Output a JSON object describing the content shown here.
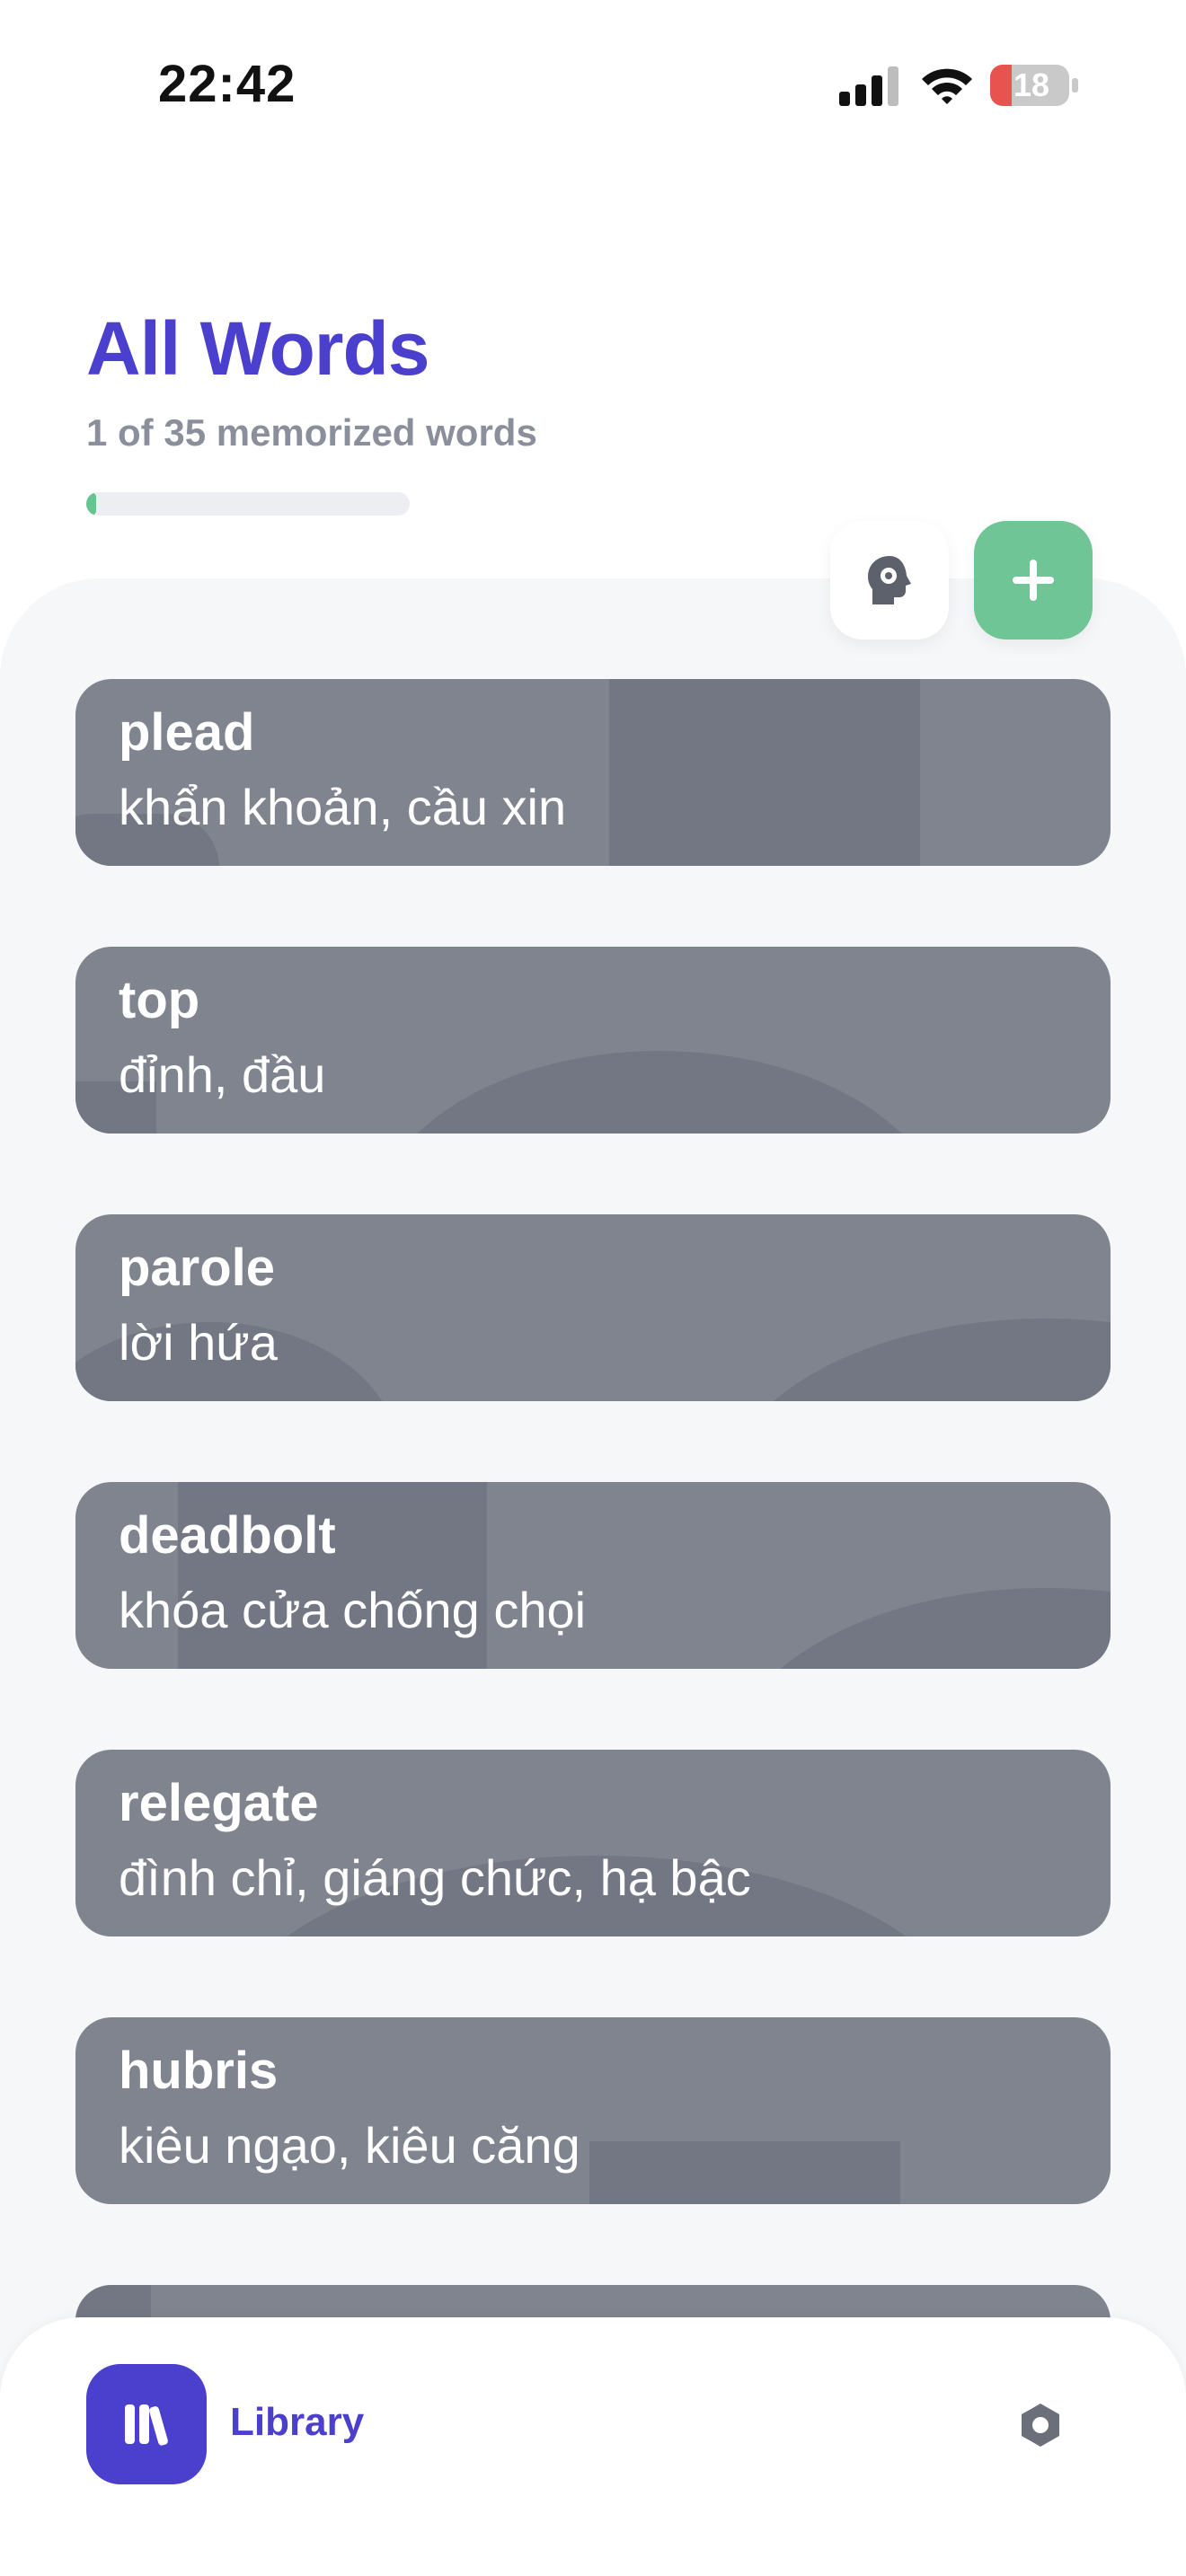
{
  "status_bar": {
    "time": "22:42",
    "battery_level": "18"
  },
  "header": {
    "title": "All Words",
    "subtitle": "1 of 35 memorized words",
    "progress_fraction": 0.03
  },
  "actions": {
    "memorize_icon": "head-icon",
    "add_icon": "plus-icon"
  },
  "words": [
    {
      "term": "plead",
      "meaning": "khẩn khoản, cầu xin"
    },
    {
      "term": "top",
      "meaning": "đỉnh, đầu"
    },
    {
      "term": "parole",
      "meaning": "lời hứa"
    },
    {
      "term": "deadbolt",
      "meaning": "khóa cửa chống chọi"
    },
    {
      "term": "relegate",
      "meaning": "đình chỉ, giáng chức, hạ bậc"
    },
    {
      "term": "hubris",
      "meaning": "kiêu ngạo, kiêu căng"
    }
  ],
  "bottom_bar": {
    "library_label": "Library",
    "library_icon": "library-icon",
    "settings_icon": "gear-icon"
  },
  "colors": {
    "accent": "#4b3fce",
    "green": "#6fc595",
    "card": "#80848f",
    "muted": "#8a8f9b"
  }
}
